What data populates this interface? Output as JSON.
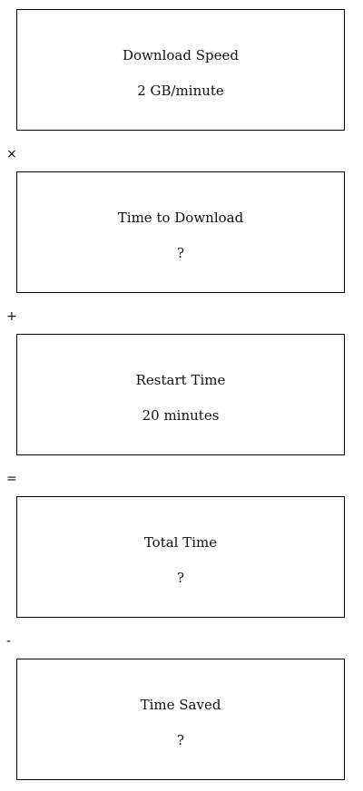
{
  "boxes": [
    {
      "title": "Download Speed",
      "value": "2 GB/minute"
    },
    {
      "title": "Time to Download",
      "value": "?"
    },
    {
      "title": "Restart Time",
      "value": "20 minutes"
    },
    {
      "title": "Total Time",
      "value": "?"
    },
    {
      "title": "Time Saved",
      "value": "?"
    }
  ],
  "operators": [
    "×",
    "+",
    "=",
    "-"
  ]
}
